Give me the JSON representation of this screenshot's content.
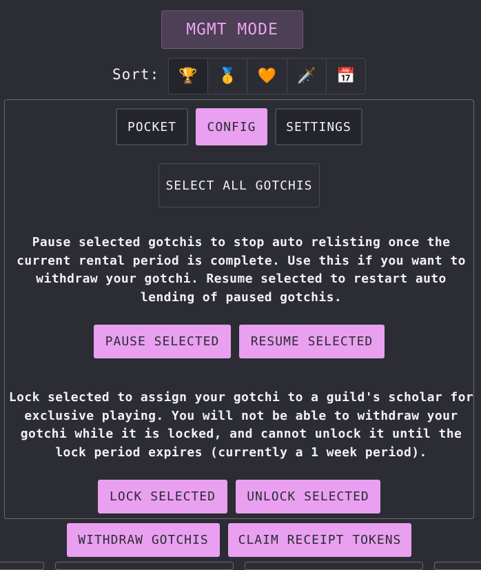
{
  "header": {
    "mode_label": "MGMT MODE"
  },
  "sort": {
    "label": "Sort:",
    "options": [
      {
        "name": "trophy",
        "glyph": "🏆"
      },
      {
        "name": "medal",
        "glyph": "🥇"
      },
      {
        "name": "heart",
        "glyph": "🧡"
      },
      {
        "name": "dagger",
        "glyph": "🗡️"
      },
      {
        "name": "calendar",
        "glyph": "📅"
      }
    ]
  },
  "tabs": [
    {
      "label": "POCKET",
      "active": false
    },
    {
      "label": "CONFIG",
      "active": true
    },
    {
      "label": "SETTINGS",
      "active": false
    }
  ],
  "config": {
    "select_all_label": "SELECT ALL GOTCHIS",
    "pause_text": "Pause selected gotchis to stop auto relisting once the current rental period is complete. Use this if you want to withdraw your gotchi. Resume selected to restart auto lending of paused gotchis.",
    "pause_label": "PAUSE SELECTED",
    "resume_label": "RESUME SELECTED",
    "lock_text": "Lock selected to assign your gotchi to a guild's scholar for exclusive playing. You will not be able to withdraw your gotchi while it is locked, and cannot unlock it until the lock period expires (currently a 1 week period).",
    "lock_label": "LOCK SELECTED",
    "unlock_label": "UNLOCK SELECTED"
  },
  "actions": {
    "withdraw_label": "WITHDRAW GOTCHIS",
    "claim_label": "CLAIM RECEIPT TOKENS"
  },
  "colors": {
    "accent": "#eaa0f0",
    "background": "#2b2c34"
  }
}
